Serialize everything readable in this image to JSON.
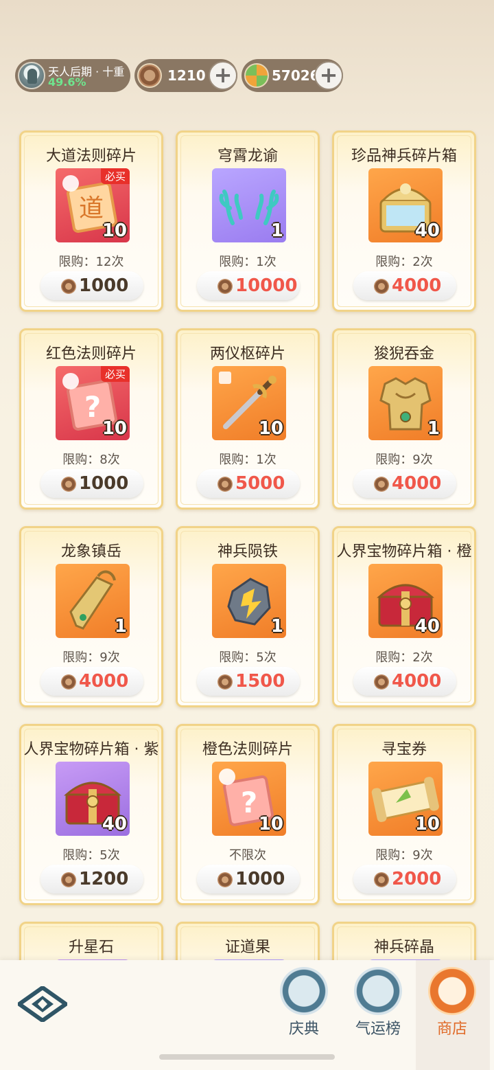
{
  "player": {
    "realm": "天人后期 · 十重",
    "progress": "49.6%"
  },
  "currency": {
    "coin": {
      "value": "1210",
      "icon": "copper-coin-icon"
    },
    "gem": {
      "value": "57026",
      "icon": "fortune-gem-icon"
    },
    "plus": "+"
  },
  "items": [
    {
      "title": "大道法则碎片",
      "qty": "10",
      "badge": "必买",
      "limit": "限购：12次",
      "price": "1000",
      "price_red": false,
      "bg": "red",
      "icon": "dao-fragment-icon"
    },
    {
      "title": "穹霄龙谕",
      "qty": "1",
      "badge": "",
      "limit": "限购：1次",
      "price": "10000",
      "price_red": true,
      "bg": "purple",
      "icon": "dragon-antler-icon"
    },
    {
      "title": "珍品神兵碎片箱",
      "qty": "40",
      "badge": "",
      "limit": "限购：2次",
      "price": "4000",
      "price_red": true,
      "bg": "orange",
      "icon": "weapon-chest-icon"
    },
    {
      "title": "红色法则碎片",
      "qty": "10",
      "badge": "必买",
      "limit": "限购：8次",
      "price": "1000",
      "price_red": false,
      "bg": "red",
      "icon": "mystery-fragment-icon"
    },
    {
      "title": "两仪枢碎片",
      "qty": "10",
      "badge": "",
      "limit": "限购：1次",
      "price": "5000",
      "price_red": true,
      "bg": "orange",
      "icon": "sword-icon"
    },
    {
      "title": "狻猊吞金",
      "qty": "1",
      "badge": "",
      "limit": "限购：9次",
      "price": "4000",
      "price_red": true,
      "bg": "orange",
      "icon": "armor-icon"
    },
    {
      "title": "龙象镇岳",
      "qty": "1",
      "badge": "",
      "limit": "限购：9次",
      "price": "4000",
      "price_red": true,
      "bg": "orange",
      "icon": "bracer-icon"
    },
    {
      "title": "神兵陨铁",
      "qty": "1",
      "badge": "",
      "limit": "限购：5次",
      "price": "1500",
      "price_red": true,
      "bg": "orange",
      "icon": "meteor-iron-icon"
    },
    {
      "title": "人界宝物碎片箱 · 橙",
      "qty": "40",
      "badge": "",
      "limit": "限购：2次",
      "price": "4000",
      "price_red": true,
      "bg": "orange",
      "icon": "treasure-chest-icon"
    },
    {
      "title": "人界宝物碎片箱 · 紫",
      "qty": "40",
      "badge": "",
      "limit": "限购：5次",
      "price": "1200",
      "price_red": false,
      "bg": "violet",
      "icon": "treasure-chest-icon"
    },
    {
      "title": "橙色法则碎片",
      "qty": "10",
      "badge": "",
      "limit": "不限次",
      "price": "1000",
      "price_red": false,
      "bg": "orange",
      "icon": "mystery-fragment-icon"
    },
    {
      "title": "寻宝券",
      "qty": "10",
      "badge": "",
      "limit": "限购：9次",
      "price": "2000",
      "price_red": true,
      "bg": "orange",
      "icon": "treasure-scroll-icon"
    },
    {
      "title": "升星石",
      "qty": "",
      "badge": "",
      "limit": "",
      "price": "",
      "price_red": false,
      "bg": "violet",
      "icon": "star-stone-icon"
    },
    {
      "title": "证道果",
      "qty": "",
      "badge": "",
      "limit": "",
      "price": "",
      "price_red": false,
      "bg": "purple",
      "icon": "dao-fruit-icon"
    },
    {
      "title": "神兵碎晶",
      "qty": "",
      "badge": "",
      "limit": "",
      "price": "",
      "price_red": false,
      "bg": "purple",
      "icon": "weapon-crystal-icon"
    }
  ],
  "nav": [
    {
      "label": "庆典",
      "icon": "celebration-icon",
      "active": false
    },
    {
      "label": "气运榜",
      "icon": "fortune-ranking-icon",
      "active": false
    },
    {
      "label": "商店",
      "icon": "shop-icon",
      "active": true
    }
  ],
  "colors": {
    "accent": "#f0574a",
    "active_tab": "#e06a28",
    "card_border": "#f1d388"
  }
}
